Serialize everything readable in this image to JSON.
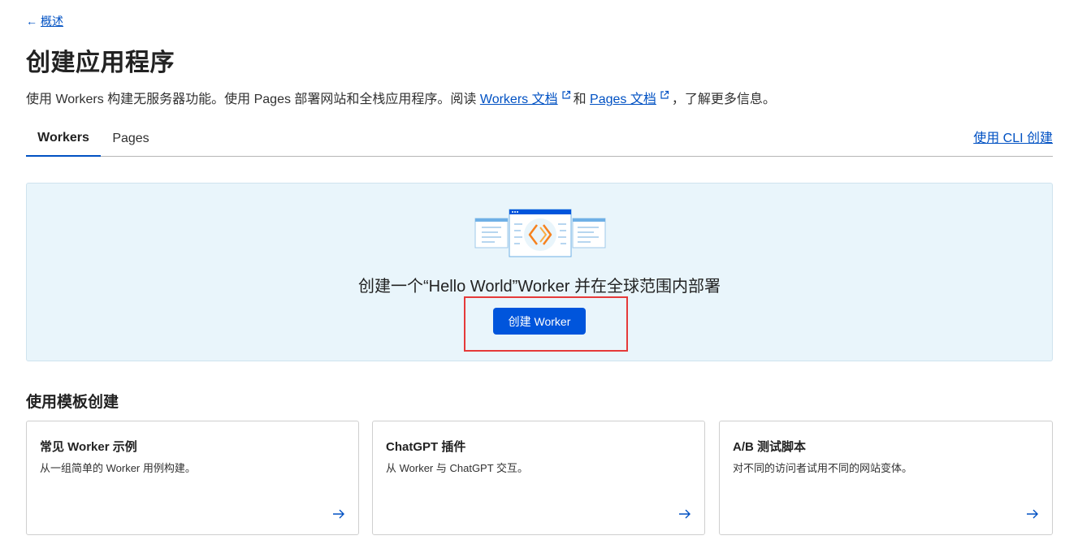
{
  "nav": {
    "back_label": "概述"
  },
  "header": {
    "title": "创建应用程序",
    "description_prefix": "使用 Workers 构建无服务器功能。使用 Pages 部署网站和全栈应用程序。阅读 ",
    "workers_docs_link": "Workers 文档",
    "description_and": "和 ",
    "pages_docs_link": "Pages 文档",
    "description_suffix": "，了解更多信息。"
  },
  "tabs": {
    "workers": "Workers",
    "pages": "Pages",
    "active": "Workers",
    "cli_link": "使用 CLI 创建"
  },
  "hero": {
    "text": "创建一个“Hello World”Worker 并在全球范围内部署",
    "button_label": "创建 Worker"
  },
  "templates": {
    "section_title": "使用模板创建",
    "cards": [
      {
        "title": "常见 Worker 示例",
        "description": "从一组简单的 Worker 用例构建。"
      },
      {
        "title": "ChatGPT 插件",
        "description": "从 Worker 与 ChatGPT 交互。"
      },
      {
        "title": "A/B 测试脚本",
        "description": "对不同的访问者试用不同的网站变体。"
      }
    ]
  },
  "colors": {
    "accent": "#0051c3",
    "button": "#0055dc",
    "hero_bg": "#e9f5fb",
    "highlight": "#e53a3a",
    "illustration_orange": "#f6821f"
  },
  "icons": {
    "back": "arrow-left-icon",
    "external": "external-link-icon",
    "card_arrow": "arrow-right-icon",
    "hero": "workers-code-illustration"
  }
}
